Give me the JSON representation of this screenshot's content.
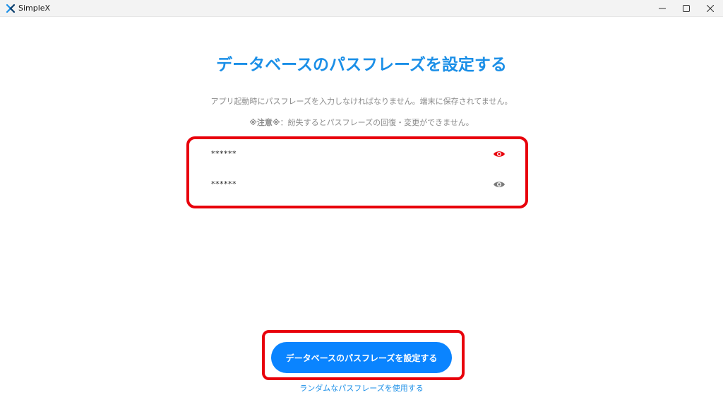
{
  "window": {
    "app_title": "SimpleX"
  },
  "main": {
    "title": "データベースのパスフレーズを設定する",
    "description": "アプリ起動時にパスフレーズを入力しなければなりません。端末に保存されてません。",
    "warning_label": "※注意※",
    "warning_text": "：紛失するとパスフレーズの回復・変更ができません。",
    "fields": [
      {
        "value": "******",
        "eye_color": "#e8000b"
      },
      {
        "value": "******",
        "eye_color": "#7a7a7a"
      }
    ],
    "primary_button_label": "データベースのパスフレーズを設定する",
    "random_link_label": "ランダムなパスフレーズを使用する"
  },
  "colors": {
    "accent": "#1b8fe7",
    "button": "#0a84ff",
    "highlight": "#e8000b"
  }
}
